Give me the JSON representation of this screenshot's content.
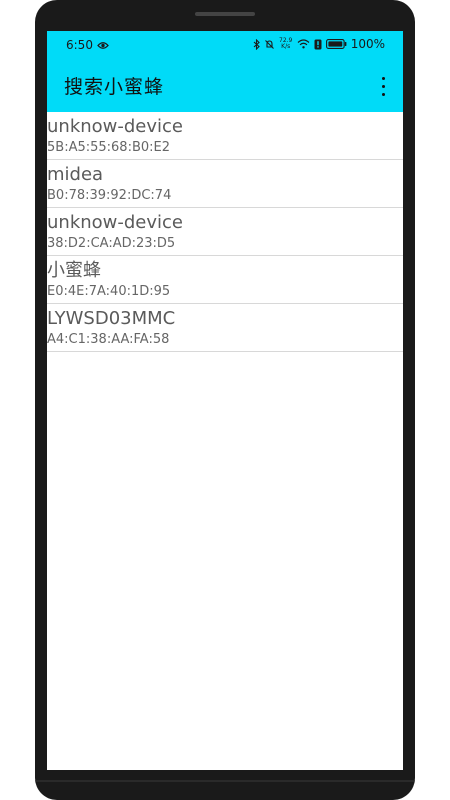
{
  "status_bar": {
    "time": "6:50",
    "net_speed_value": "72.9",
    "net_speed_unit": "K/s",
    "battery": "100%"
  },
  "toolbar": {
    "title": "搜索小蜜蜂"
  },
  "devices": [
    {
      "name": "unknow-device",
      "mac": "5B:A5:55:68:B0:E2"
    },
    {
      "name": "midea",
      "mac": "B0:78:39:92:DC:74"
    },
    {
      "name": "unknow-device",
      "mac": "38:D2:CA:AD:23:D5"
    },
    {
      "name": "小蜜蜂",
      "mac": "E0:4E:7A:40:1D:95"
    },
    {
      "name": "LYWSD03MMC",
      "mac": "A4:C1:38:AA:FA:58"
    }
  ],
  "colors": {
    "app_bar": "#00dbf8",
    "phone_frame": "#1a1a1a"
  }
}
